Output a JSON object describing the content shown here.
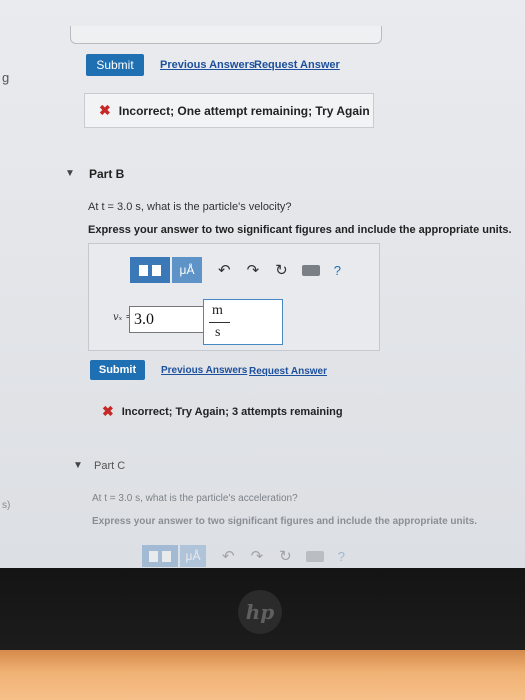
{
  "edge_text": {
    "top": "g",
    "bottom": "s)"
  },
  "part_a": {
    "submit_label": "Submit",
    "previous_answers": "Previous Answers",
    "request_answer": "Request Answer",
    "feedback_icon": "x-mark",
    "feedback": "Incorrect; One attempt remaining; Try Again"
  },
  "part_b": {
    "title": "Part B",
    "question": "At t = 3.0 s, what is the particle's velocity?",
    "instruction": "Express your answer to two significant figures and include the appropriate units.",
    "toolbar": {
      "mu_label": "μÅ",
      "undo_symbol": "↶",
      "redo_symbol": "↷",
      "reset_symbol": "↻",
      "help_symbol": "?"
    },
    "variable_label": "vₓ =",
    "value": "3.0",
    "unit_numerator": "m",
    "unit_denominator": "s",
    "submit_label": "Submit",
    "previous_answers": "Previous Answers",
    "request_answer": "Request Answer",
    "feedback": "Incorrect; Try Again; 3 attempts remaining"
  },
  "part_c": {
    "title": "Part C",
    "question": "At t = 3.0 s, what is the particle's acceleration?",
    "instruction": "Express your answer to two significant figures and include the appropriate units.",
    "toolbar": {
      "mu_label": "μÅ",
      "undo_symbol": "↶",
      "redo_symbol": "↷",
      "reset_symbol": "↻",
      "help_symbol": "?"
    }
  },
  "device": {
    "logo": "hp"
  },
  "colors": {
    "accent": "#1f6fb3",
    "error": "#c62828",
    "link": "#1c4f9c"
  }
}
